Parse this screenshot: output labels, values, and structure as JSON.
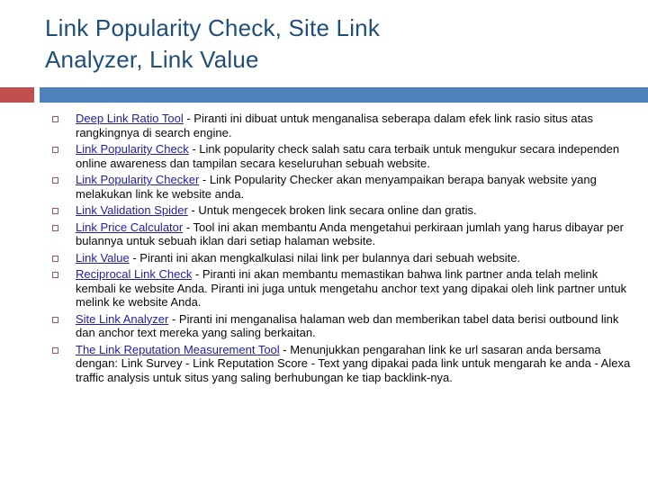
{
  "slide": {
    "title": "Link Popularity Check, Site Link\nAnalyzer, Link Value",
    "title_color": "#1F4E79",
    "accent_red": "#C0504D",
    "accent_blue": "#4F81BD",
    "bullet_marker_color": "#9A5B55",
    "link_color": "#1F1FA0",
    "body_color": "#0A0A0A",
    "background": "#FFFFFF"
  },
  "bullets": [
    {
      "link": "Deep Link Ratio Tool",
      "text": " - Piranti ini dibuat untuk menganalisa seberapa dalam efek link rasio situs atas rangkingnya di search engine."
    },
    {
      "link": "Link Popularity Check",
      "text": " - Link popularity check salah satu cara terbaik untuk mengukur secara independen online awareness dan tampilan secara keseluruhan sebuah website."
    },
    {
      "link": "Link Popularity Checker",
      "text": " - Link Popularity Checker akan menyampaikan berapa banyak website yang melakukan link ke website anda."
    },
    {
      "link": "Link Validation Spider",
      "text": " - Untuk mengecek broken link secara online dan gratis."
    },
    {
      "link": "Link Price Calculator",
      "text": " - Tool ini akan membantu Anda mengetahui perkiraan jumlah yang harus dibayar per bulannya untuk sebuah iklan dari setiap halaman website."
    },
    {
      "link": "Link Value",
      "text": " - Piranti ini akan mengkalkulasi nilai link per bulannya dari sebuah website."
    },
    {
      "link": "Reciprocal Link Check",
      "text": " - Piranti ini akan membantu memastikan bahwa link partner anda telah melink kembali ke website Anda. Piranti ini juga untuk mengetahu anchor text yang dipakai oleh link partner untuk melink ke website Anda."
    },
    {
      "link": "Site Link Analyzer",
      "text": " - Piranti ini menganalisa halaman web dan memberikan tabel data berisi outbound link dan anchor text mereka yang saling berkaitan."
    },
    {
      "link": "The Link Reputation Measurement Tool",
      "text": " - Menunjukkan pengarahan link ke url sasaran anda bersama dengan: Link Survey - Link Reputation Score - Text yang dipakai pada link untuk mengarah ke anda - Alexa traffic analysis untuk situs yang saling berhubungan ke tiap backlink-nya."
    }
  ]
}
